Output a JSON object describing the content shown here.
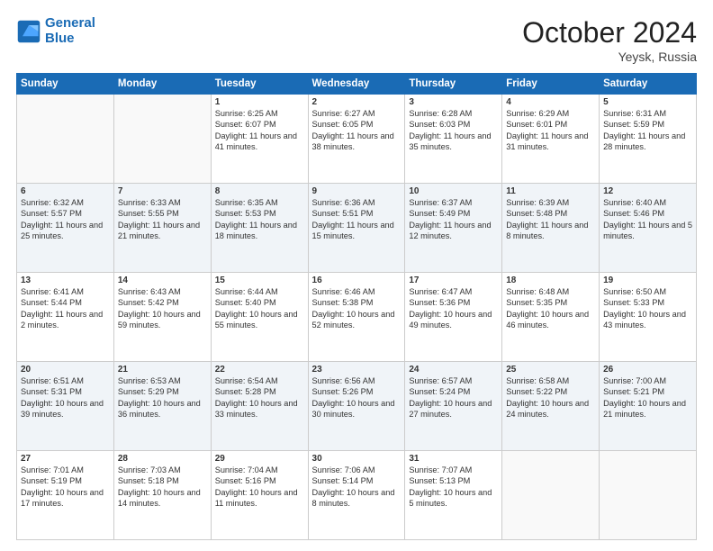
{
  "header": {
    "logo_line1": "General",
    "logo_line2": "Blue",
    "month": "October 2024",
    "location": "Yeysk, Russia"
  },
  "weekdays": [
    "Sunday",
    "Monday",
    "Tuesday",
    "Wednesday",
    "Thursday",
    "Friday",
    "Saturday"
  ],
  "weeks": [
    [
      {
        "day": "",
        "info": ""
      },
      {
        "day": "",
        "info": ""
      },
      {
        "day": "1",
        "info": "Sunrise: 6:25 AM\nSunset: 6:07 PM\nDaylight: 11 hours and 41 minutes."
      },
      {
        "day": "2",
        "info": "Sunrise: 6:27 AM\nSunset: 6:05 PM\nDaylight: 11 hours and 38 minutes."
      },
      {
        "day": "3",
        "info": "Sunrise: 6:28 AM\nSunset: 6:03 PM\nDaylight: 11 hours and 35 minutes."
      },
      {
        "day": "4",
        "info": "Sunrise: 6:29 AM\nSunset: 6:01 PM\nDaylight: 11 hours and 31 minutes."
      },
      {
        "day": "5",
        "info": "Sunrise: 6:31 AM\nSunset: 5:59 PM\nDaylight: 11 hours and 28 minutes."
      }
    ],
    [
      {
        "day": "6",
        "info": "Sunrise: 6:32 AM\nSunset: 5:57 PM\nDaylight: 11 hours and 25 minutes."
      },
      {
        "day": "7",
        "info": "Sunrise: 6:33 AM\nSunset: 5:55 PM\nDaylight: 11 hours and 21 minutes."
      },
      {
        "day": "8",
        "info": "Sunrise: 6:35 AM\nSunset: 5:53 PM\nDaylight: 11 hours and 18 minutes."
      },
      {
        "day": "9",
        "info": "Sunrise: 6:36 AM\nSunset: 5:51 PM\nDaylight: 11 hours and 15 minutes."
      },
      {
        "day": "10",
        "info": "Sunrise: 6:37 AM\nSunset: 5:49 PM\nDaylight: 11 hours and 12 minutes."
      },
      {
        "day": "11",
        "info": "Sunrise: 6:39 AM\nSunset: 5:48 PM\nDaylight: 11 hours and 8 minutes."
      },
      {
        "day": "12",
        "info": "Sunrise: 6:40 AM\nSunset: 5:46 PM\nDaylight: 11 hours and 5 minutes."
      }
    ],
    [
      {
        "day": "13",
        "info": "Sunrise: 6:41 AM\nSunset: 5:44 PM\nDaylight: 11 hours and 2 minutes."
      },
      {
        "day": "14",
        "info": "Sunrise: 6:43 AM\nSunset: 5:42 PM\nDaylight: 10 hours and 59 minutes."
      },
      {
        "day": "15",
        "info": "Sunrise: 6:44 AM\nSunset: 5:40 PM\nDaylight: 10 hours and 55 minutes."
      },
      {
        "day": "16",
        "info": "Sunrise: 6:46 AM\nSunset: 5:38 PM\nDaylight: 10 hours and 52 minutes."
      },
      {
        "day": "17",
        "info": "Sunrise: 6:47 AM\nSunset: 5:36 PM\nDaylight: 10 hours and 49 minutes."
      },
      {
        "day": "18",
        "info": "Sunrise: 6:48 AM\nSunset: 5:35 PM\nDaylight: 10 hours and 46 minutes."
      },
      {
        "day": "19",
        "info": "Sunrise: 6:50 AM\nSunset: 5:33 PM\nDaylight: 10 hours and 43 minutes."
      }
    ],
    [
      {
        "day": "20",
        "info": "Sunrise: 6:51 AM\nSunset: 5:31 PM\nDaylight: 10 hours and 39 minutes."
      },
      {
        "day": "21",
        "info": "Sunrise: 6:53 AM\nSunset: 5:29 PM\nDaylight: 10 hours and 36 minutes."
      },
      {
        "day": "22",
        "info": "Sunrise: 6:54 AM\nSunset: 5:28 PM\nDaylight: 10 hours and 33 minutes."
      },
      {
        "day": "23",
        "info": "Sunrise: 6:56 AM\nSunset: 5:26 PM\nDaylight: 10 hours and 30 minutes."
      },
      {
        "day": "24",
        "info": "Sunrise: 6:57 AM\nSunset: 5:24 PM\nDaylight: 10 hours and 27 minutes."
      },
      {
        "day": "25",
        "info": "Sunrise: 6:58 AM\nSunset: 5:22 PM\nDaylight: 10 hours and 24 minutes."
      },
      {
        "day": "26",
        "info": "Sunrise: 7:00 AM\nSunset: 5:21 PM\nDaylight: 10 hours and 21 minutes."
      }
    ],
    [
      {
        "day": "27",
        "info": "Sunrise: 7:01 AM\nSunset: 5:19 PM\nDaylight: 10 hours and 17 minutes."
      },
      {
        "day": "28",
        "info": "Sunrise: 7:03 AM\nSunset: 5:18 PM\nDaylight: 10 hours and 14 minutes."
      },
      {
        "day": "29",
        "info": "Sunrise: 7:04 AM\nSunset: 5:16 PM\nDaylight: 10 hours and 11 minutes."
      },
      {
        "day": "30",
        "info": "Sunrise: 7:06 AM\nSunset: 5:14 PM\nDaylight: 10 hours and 8 minutes."
      },
      {
        "day": "31",
        "info": "Sunrise: 7:07 AM\nSunset: 5:13 PM\nDaylight: 10 hours and 5 minutes."
      },
      {
        "day": "",
        "info": ""
      },
      {
        "day": "",
        "info": ""
      }
    ]
  ]
}
